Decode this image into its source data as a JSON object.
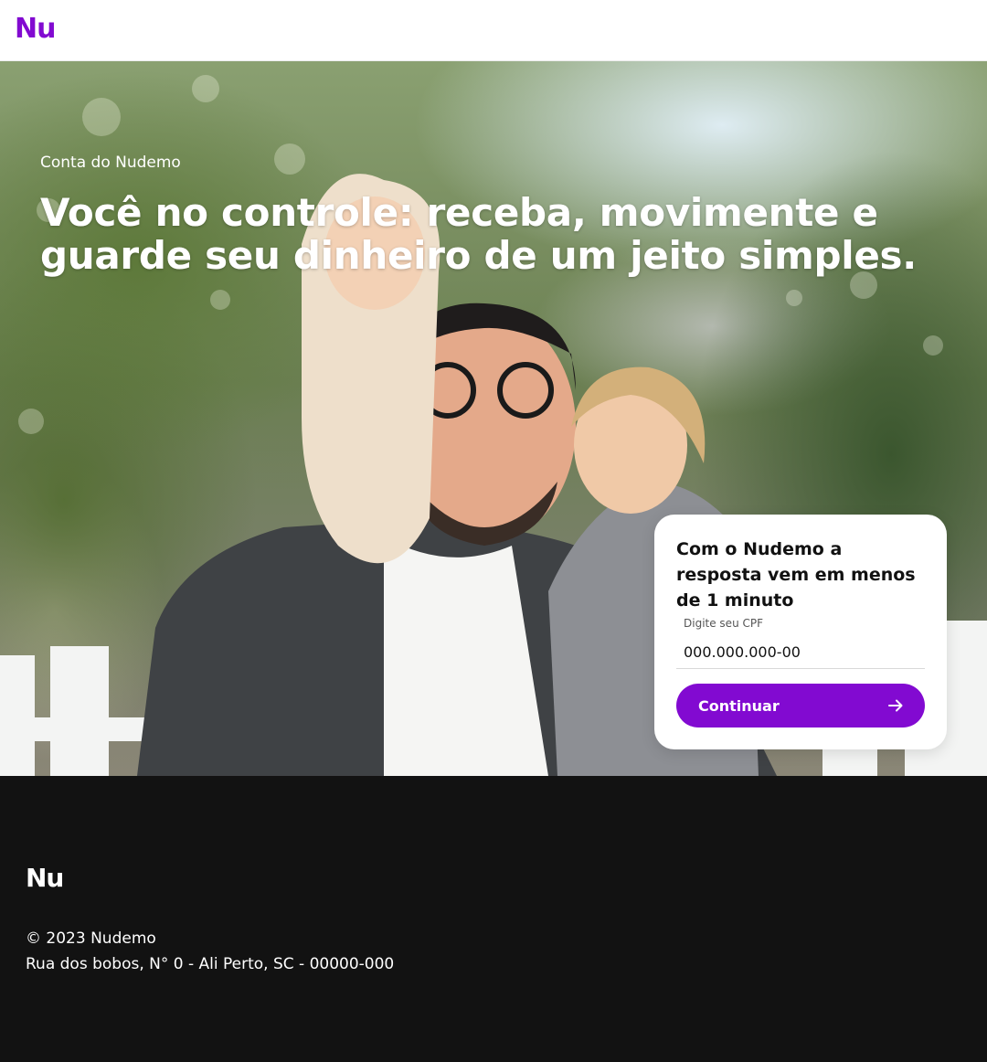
{
  "header": {
    "logo": "Nu"
  },
  "hero": {
    "eyebrow": "Conta do Nudemo",
    "title": "Você no controle: receba, movimente e guarde seu dinheiro de um jeito simples."
  },
  "signup_card": {
    "title": "Com o Nudemo a resposta vem em menos de 1 minuto",
    "cpf_label": "Digite seu CPF",
    "cpf_placeholder": "000.000.000-00",
    "continue_label": "Continuar",
    "continue_icon": "arrow-right-icon"
  },
  "footer": {
    "logo": "Nu",
    "copyright": "© 2023 Nudemo",
    "address": "Rua dos bobos, N° 0 - Ali Perto, SC - 00000-000"
  },
  "colors": {
    "brand_purple": "#820ad1",
    "footer_bg": "#121212",
    "header_bg": "#ffffff"
  }
}
